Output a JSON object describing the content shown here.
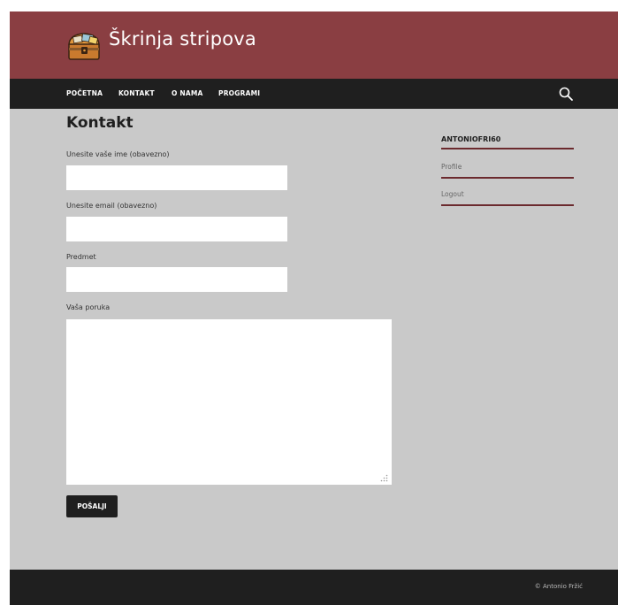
{
  "header": {
    "site_title": "Škrinja stripova",
    "logo_icon": "treasure-chest-icon",
    "background_color": "#8a3e42"
  },
  "nav": {
    "items": [
      {
        "label": "POČETNA"
      },
      {
        "label": "KONTAKT"
      },
      {
        "label": "O NAMA"
      },
      {
        "label": "PROGRAMI"
      }
    ],
    "search_icon": "search-icon"
  },
  "main": {
    "page_title": "Kontakt",
    "form": {
      "name_label": "Unesite vaše ime (obavezno)",
      "name_value": "",
      "email_label": "Unesite email (obavezno)",
      "email_value": "",
      "subject_label": "Predmet",
      "subject_value": "",
      "message_label": "Vaša poruka",
      "message_value": "",
      "submit_label": "POŠALJI"
    }
  },
  "sidebar": {
    "username": "ANTONIOFRI60",
    "links": [
      {
        "label": "Profile"
      },
      {
        "label": "Logout"
      }
    ],
    "accent_color": "#6b2a2e"
  },
  "footer": {
    "copyright": "© Antonio Fržić"
  }
}
